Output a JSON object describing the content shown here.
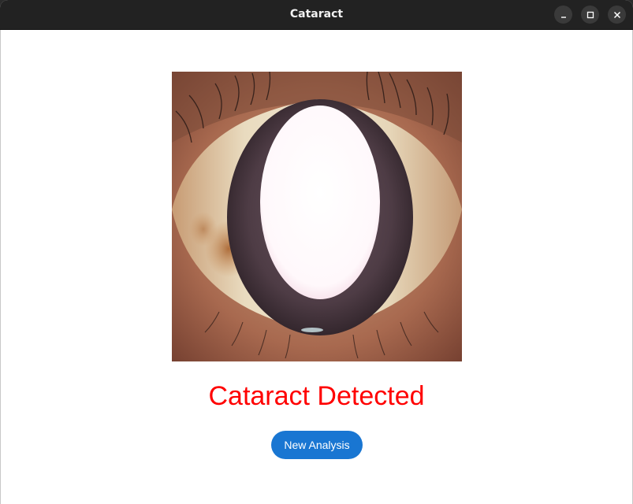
{
  "window": {
    "title": "Cataract",
    "controls": {
      "minimize_icon": "minimize-icon",
      "maximize_icon": "maximize-icon",
      "close_icon": "close-icon"
    }
  },
  "main": {
    "image_icon": "eye-photo",
    "result_text": "Cataract Detected",
    "result_color": "#ff0000",
    "button_label": "New Analysis",
    "button_color": "#1976d2"
  }
}
